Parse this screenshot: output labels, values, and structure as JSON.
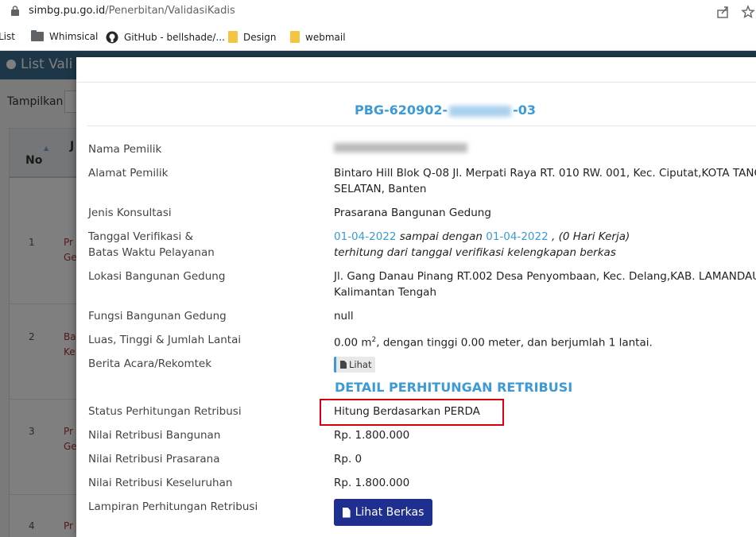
{
  "browser": {
    "url_host": "simbg.pu.go.id",
    "url_path": "/Penerbitan/ValidasiKadis",
    "bookmarks": [
      "List",
      "Whimsical",
      "GitHub - bellshade/...",
      "Design",
      "webmail"
    ]
  },
  "page": {
    "title": "List Vali",
    "tampilkan_label": "Tampilkan",
    "table": {
      "col_no": "No",
      "col_j": "J",
      "rows": [
        {
          "no": "1",
          "text": "Pr\nGe"
        },
        {
          "no": "2",
          "text": "Ba\nKe"
        },
        {
          "no": "3",
          "text": "Pr\nGe"
        },
        {
          "no": "4",
          "text": "Pr\nGe"
        }
      ]
    }
  },
  "modal": {
    "id_prefix": "PBG-620902-",
    "id_suffix": "-03",
    "fields": {
      "nama_pemilik_label": "Nama Pemilik",
      "alamat_pemilik_label": "Alamat Pemilik",
      "alamat_pemilik_line1": "Bintaro Hill Blok Q-08 Jl. Merpati Raya RT. 010 RW. 001, Kec. Ciputat,KOTA TANG",
      "alamat_pemilik_line2": "SELATAN, Banten",
      "jenis_konsultasi_label": "Jenis Konsultasi",
      "jenis_konsultasi_value": "Prasarana Bangunan Gedung",
      "tanggal_label_line1": "Tanggal Verifikasi &",
      "tanggal_label_line2": "Batas Waktu Pelayanan",
      "tanggal_start": "01-04-2022",
      "tanggal_mid": " sampai dengan ",
      "tanggal_end": "01-04-2022",
      "tanggal_tail": " , (0 Hari Kerja)",
      "tanggal_note": "terhitung dari tanggal verifikasi kelengkapan berkas",
      "lokasi_label": "Lokasi Bangunan Gedung",
      "lokasi_line1": "Jl. Gang Danau Pinang RT.002 Desa Penyombaan, Kec. Delang,KAB. LAMANDAU",
      "lokasi_line2": "Kalimantan Tengah",
      "fungsi_label": "Fungsi Bangunan Gedung",
      "fungsi_value": "null",
      "luas_label": "Luas, Tinggi & Jumlah Lantai",
      "luas_value_a": "0.00 m",
      "luas_sup": "2",
      "luas_value_b": ", dengan tinggi 0.00 meter, dan berjumlah 1 lantai.",
      "berita_label": "Berita Acara/Rekomtek",
      "berita_button": "Lihat"
    },
    "detail_heading": "DETAIL PERHITUNGAN RETRIBUSI",
    "retribusi": {
      "status_label": "Status Perhitungan Retribusi",
      "status_value": "Hitung Berdasarkan PERDA",
      "bangunan_label": "Nilai Retribusi Bangunan",
      "bangunan_value": "Rp. 1.800.000",
      "prasarana_label": "Nilai Retribusi Prasarana",
      "prasarana_value": "Rp. 0",
      "keseluruhan_label": "Nilai Retribusi Keseluruhan",
      "keseluruhan_value": "Rp. 1.800.000",
      "lampiran_label": "Lampiran Perhitungan Retribusi",
      "lampiran_button": "Lihat Berkas"
    }
  },
  "colors": {
    "accent": "#3c9ad6",
    "header": "#3c6e91",
    "button": "#1f2f8f",
    "highlight_box": "#d9000d"
  }
}
